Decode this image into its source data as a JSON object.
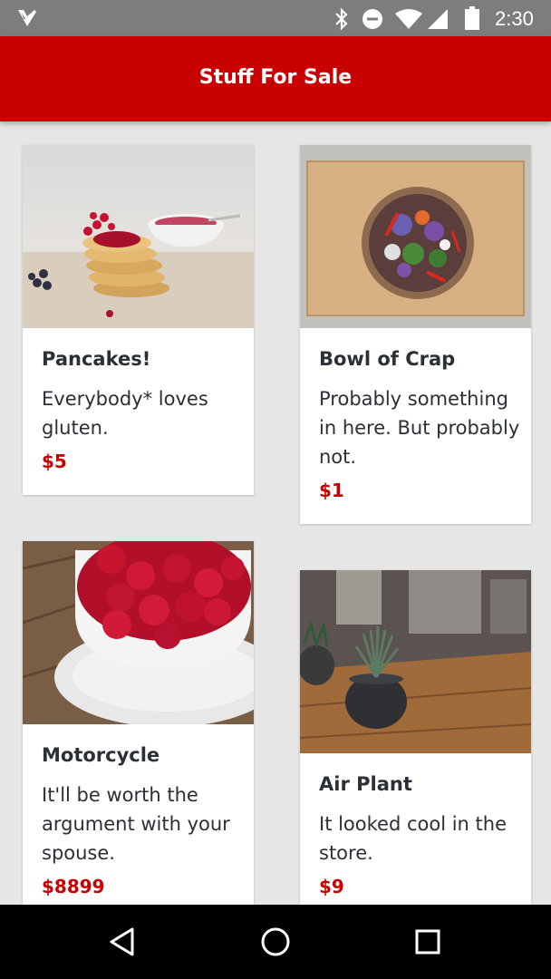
{
  "status_bar": {
    "time": "2:30",
    "icons": [
      "app-notification-icon",
      "bluetooth-icon",
      "do-not-disturb-icon",
      "wifi-icon",
      "cell-signal-icon",
      "battery-icon"
    ]
  },
  "app_bar": {
    "title": "Stuff For Sale",
    "color": "#c80000"
  },
  "items": [
    {
      "name": "Pancakes!",
      "description": "Everybody* loves gluten.",
      "price": "$5",
      "image": "pancakes-photo"
    },
    {
      "name": "Bowl of Crap",
      "description": "Probably some­thing in here. But probably not.",
      "price": "$1",
      "image": "salad-bowl-photo"
    },
    {
      "name": "Motorcycle",
      "description": "It'll be worth the argument with your spouse.",
      "price": "$8899",
      "image": "raspberries-photo"
    },
    {
      "name": "Air Plant",
      "description": "It looked cool in the store.",
      "price": "$9",
      "image": "air-plant-photo"
    }
  ],
  "nav_bar": {
    "buttons": [
      "back-icon",
      "home-icon",
      "recents-icon"
    ]
  },
  "colors": {
    "accent": "#c80000",
    "background": "#e6e6e6",
    "text": "#2b2f36"
  }
}
